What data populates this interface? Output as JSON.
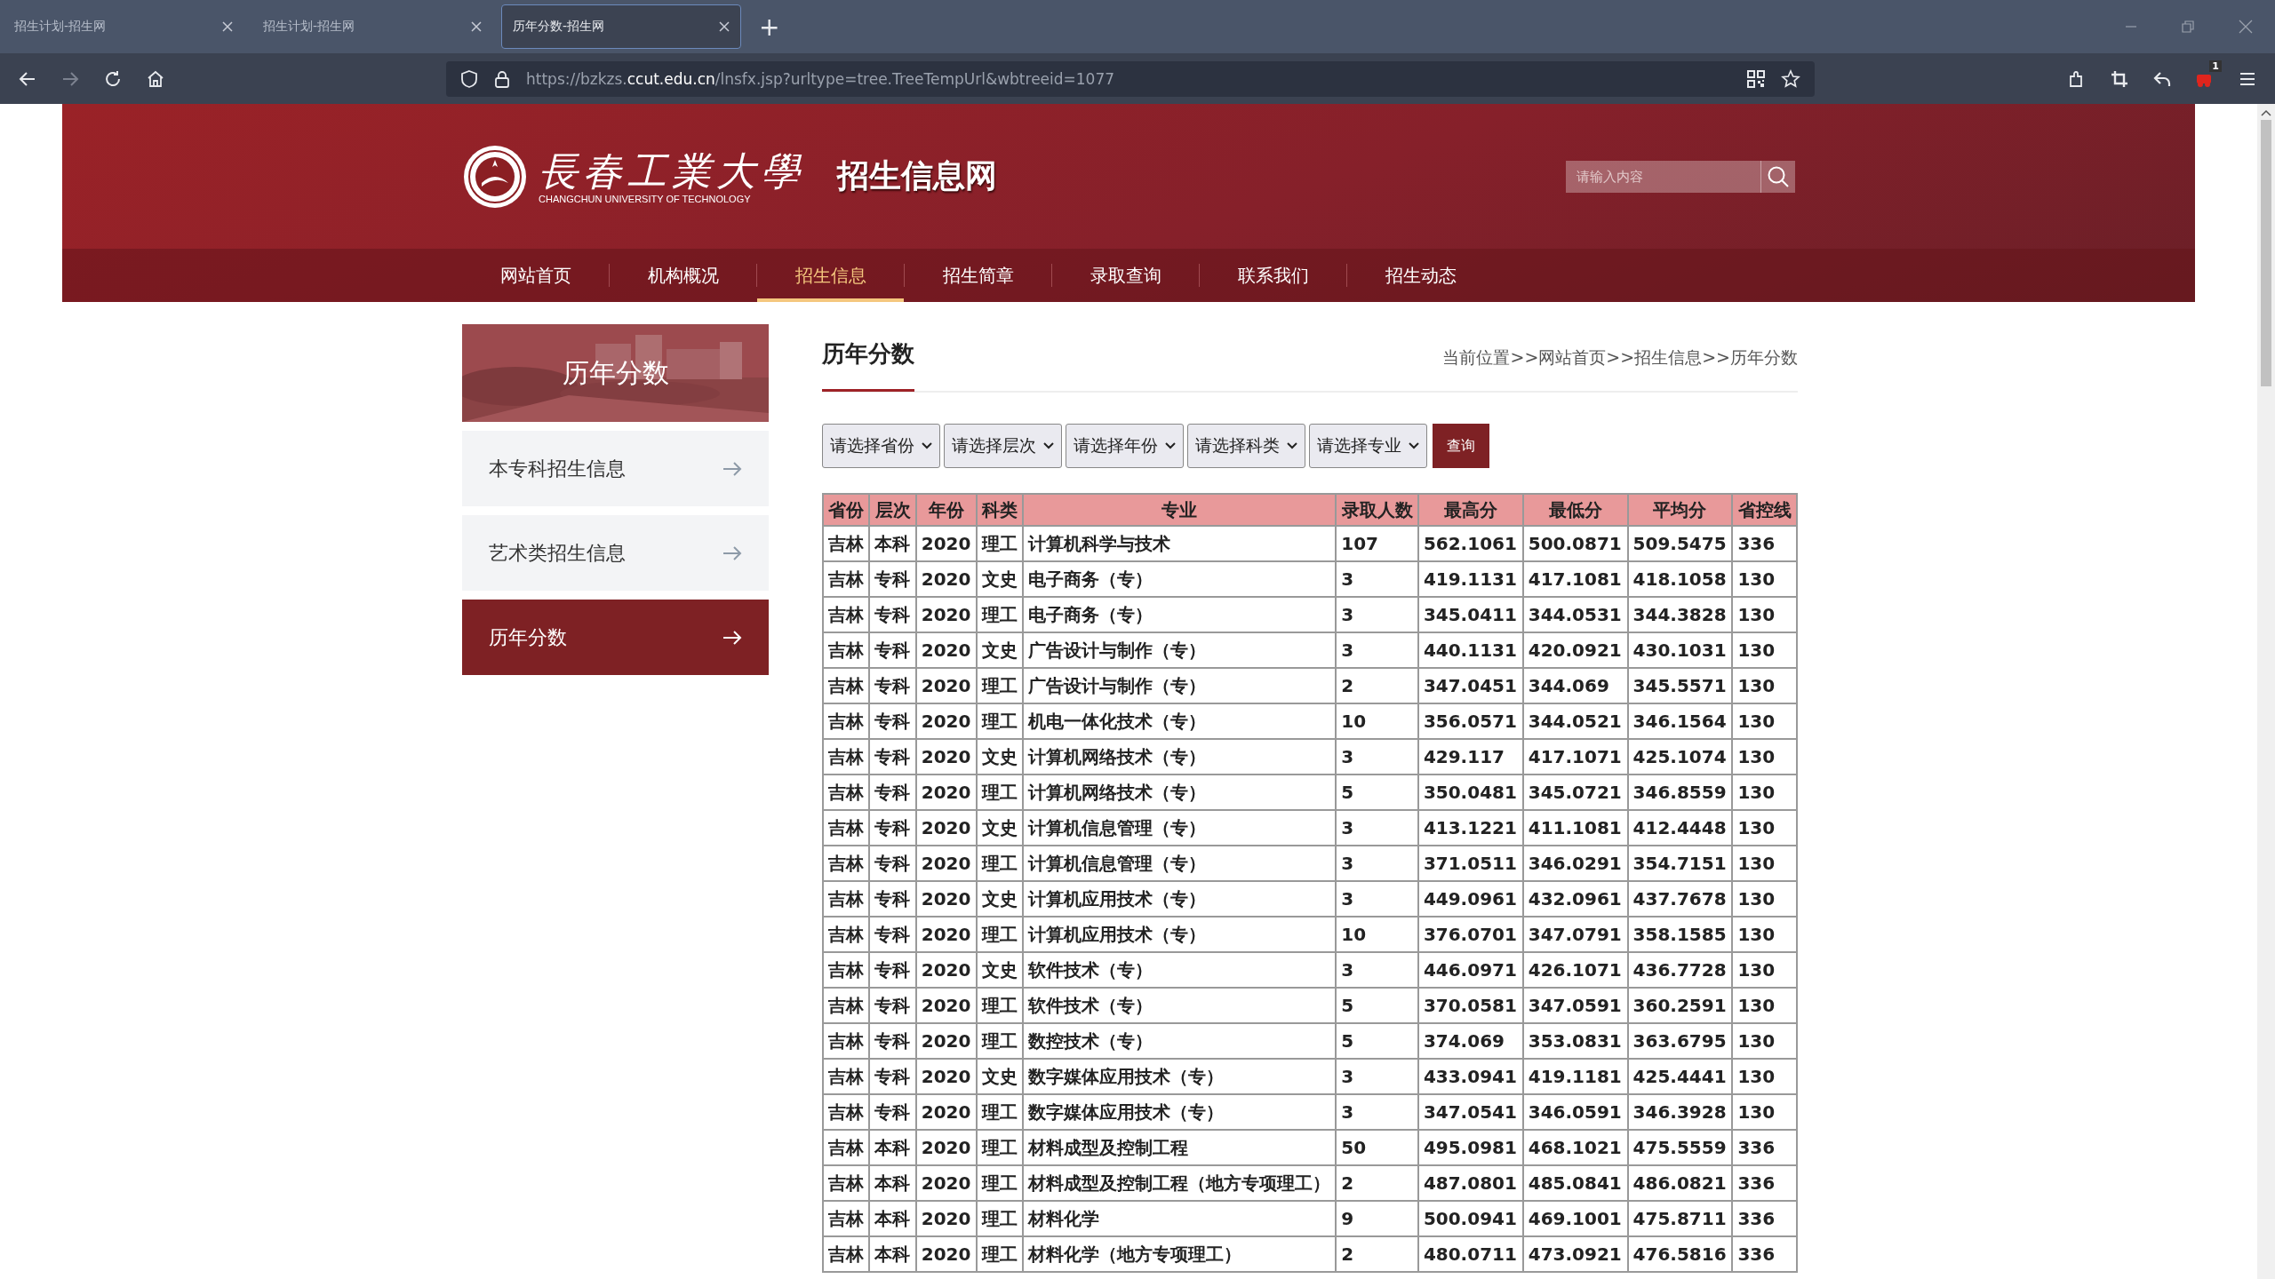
{
  "browser": {
    "tabs": [
      {
        "title": "招生计划-招生网",
        "selected": false
      },
      {
        "title": "招生计划-招生网",
        "selected": false
      },
      {
        "title": "历年分数-招生网",
        "selected": true
      }
    ],
    "new_tab": "+",
    "url": {
      "scheme": "https://bzkzs.",
      "host": "ccut.edu.cn",
      "path": "/lnsfx.jsp?urltype=tree.TreeTempUrl&wbtreeid=1077"
    },
    "extension_badge": "1"
  },
  "header": {
    "logo_calligraphy": "長春工業大學",
    "logo_english": "CHANGCHUN UNIVERSITY OF TECHNOLOGY",
    "site_title": "招生信息网",
    "search": {
      "placeholder": "请输入内容"
    }
  },
  "nav": [
    {
      "label": "网站首页",
      "selected": false
    },
    {
      "label": "机构概况",
      "selected": false
    },
    {
      "label": "招生信息",
      "selected": true
    },
    {
      "label": "招生简章",
      "selected": false
    },
    {
      "label": "录取查询",
      "selected": false
    },
    {
      "label": "联系我们",
      "selected": false
    },
    {
      "label": "招生动态",
      "selected": false
    }
  ],
  "sidebar": {
    "banner_title": "历年分数",
    "items": [
      {
        "label": "本专科招生信息",
        "selected": false
      },
      {
        "label": "艺术类招生信息",
        "selected": false
      },
      {
        "label": "历年分数",
        "selected": true
      }
    ]
  },
  "main": {
    "title": "历年分数",
    "breadcrumb": "当前位置>>网站首页>>招生信息>>历年分数",
    "filters": [
      "请选择省份",
      "请选择层次",
      "请选择年份",
      "请选择科类",
      "请选择专业"
    ],
    "query_button": "查询",
    "table": {
      "columns": [
        "省份",
        "层次",
        "年份",
        "科类",
        "专业",
        "录取人数",
        "最高分",
        "最低分",
        "平均分",
        "省控线"
      ],
      "rows": [
        [
          "吉林",
          "本科",
          "2020",
          "理工",
          "计算机科学与技术",
          "107",
          "562.1061",
          "500.0871",
          "509.5475",
          "336"
        ],
        [
          "吉林",
          "专科",
          "2020",
          "文史",
          "电子商务（专）",
          "3",
          "419.1131",
          "417.1081",
          "418.1058",
          "130"
        ],
        [
          "吉林",
          "专科",
          "2020",
          "理工",
          "电子商务（专）",
          "3",
          "345.0411",
          "344.0531",
          "344.3828",
          "130"
        ],
        [
          "吉林",
          "专科",
          "2020",
          "文史",
          "广告设计与制作（专）",
          "3",
          "440.1131",
          "420.0921",
          "430.1031",
          "130"
        ],
        [
          "吉林",
          "专科",
          "2020",
          "理工",
          "广告设计与制作（专）",
          "2",
          "347.0451",
          "344.069",
          "345.5571",
          "130"
        ],
        [
          "吉林",
          "专科",
          "2020",
          "理工",
          "机电一体化技术（专）",
          "10",
          "356.0571",
          "344.0521",
          "346.1564",
          "130"
        ],
        [
          "吉林",
          "专科",
          "2020",
          "文史",
          "计算机网络技术（专）",
          "3",
          "429.117",
          "417.1071",
          "425.1074",
          "130"
        ],
        [
          "吉林",
          "专科",
          "2020",
          "理工",
          "计算机网络技术（专）",
          "5",
          "350.0481",
          "345.0721",
          "346.8559",
          "130"
        ],
        [
          "吉林",
          "专科",
          "2020",
          "文史",
          "计算机信息管理（专）",
          "3",
          "413.1221",
          "411.1081",
          "412.4448",
          "130"
        ],
        [
          "吉林",
          "专科",
          "2020",
          "理工",
          "计算机信息管理（专）",
          "3",
          "371.0511",
          "346.0291",
          "354.7151",
          "130"
        ],
        [
          "吉林",
          "专科",
          "2020",
          "文史",
          "计算机应用技术（专）",
          "3",
          "449.0961",
          "432.0961",
          "437.7678",
          "130"
        ],
        [
          "吉林",
          "专科",
          "2020",
          "理工",
          "计算机应用技术（专）",
          "10",
          "376.0701",
          "347.0791",
          "358.1585",
          "130"
        ],
        [
          "吉林",
          "专科",
          "2020",
          "文史",
          "软件技术（专）",
          "3",
          "446.0971",
          "426.1071",
          "436.7728",
          "130"
        ],
        [
          "吉林",
          "专科",
          "2020",
          "理工",
          "软件技术（专）",
          "5",
          "370.0581",
          "347.0591",
          "360.2591",
          "130"
        ],
        [
          "吉林",
          "专科",
          "2020",
          "理工",
          "数控技术（专）",
          "5",
          "374.069",
          "353.0831",
          "363.6795",
          "130"
        ],
        [
          "吉林",
          "专科",
          "2020",
          "文史",
          "数字媒体应用技术（专）",
          "3",
          "433.0941",
          "419.1181",
          "425.4441",
          "130"
        ],
        [
          "吉林",
          "专科",
          "2020",
          "理工",
          "数字媒体应用技术（专）",
          "3",
          "347.0541",
          "346.0591",
          "346.3928",
          "130"
        ],
        [
          "吉林",
          "本科",
          "2020",
          "理工",
          "材料成型及控制工程",
          "50",
          "495.0981",
          "468.1021",
          "475.5559",
          "336"
        ],
        [
          "吉林",
          "本科",
          "2020",
          "理工",
          "材料成型及控制工程（地方专项理工）",
          "2",
          "487.0801",
          "485.0841",
          "486.0821",
          "336"
        ],
        [
          "吉林",
          "本科",
          "2020",
          "理工",
          "材料化学",
          "9",
          "500.0941",
          "469.1001",
          "475.8711",
          "336"
        ],
        [
          "吉林",
          "本科",
          "2020",
          "理工",
          "材料化学（地方专项理工）",
          "2",
          "480.0711",
          "473.0921",
          "476.5816",
          "336"
        ]
      ]
    }
  }
}
